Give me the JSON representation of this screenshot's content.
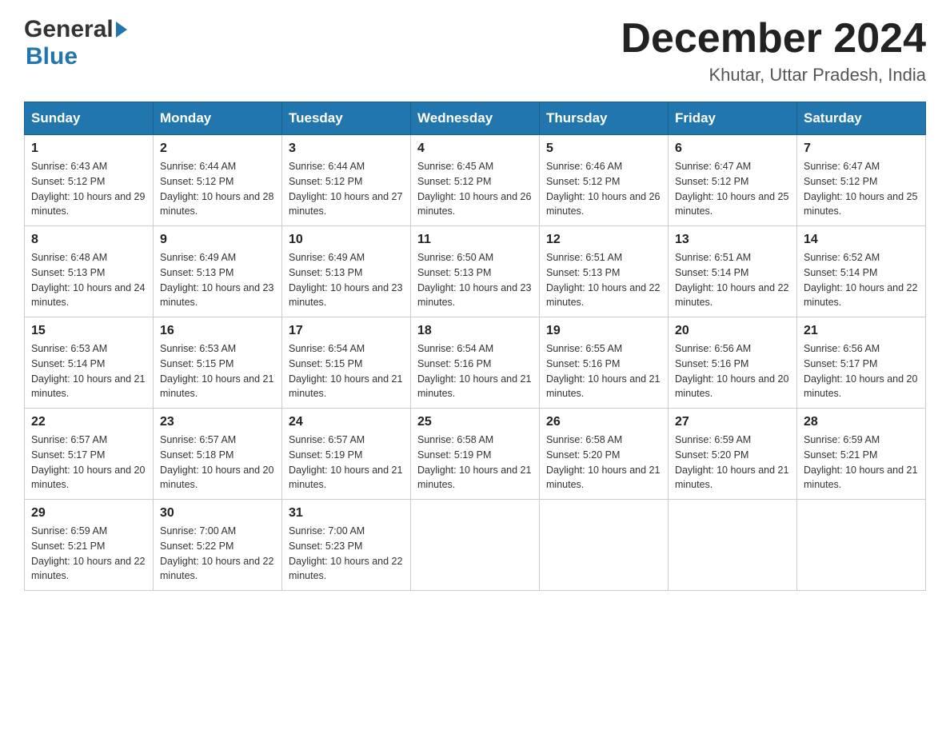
{
  "header": {
    "logo_general": "General",
    "logo_blue": "Blue",
    "month_title": "December 2024",
    "location": "Khutar, Uttar Pradesh, India"
  },
  "days_of_week": [
    "Sunday",
    "Monday",
    "Tuesday",
    "Wednesday",
    "Thursday",
    "Friday",
    "Saturday"
  ],
  "weeks": [
    [
      {
        "day": "1",
        "sunrise": "Sunrise: 6:43 AM",
        "sunset": "Sunset: 5:12 PM",
        "daylight": "Daylight: 10 hours and 29 minutes."
      },
      {
        "day": "2",
        "sunrise": "Sunrise: 6:44 AM",
        "sunset": "Sunset: 5:12 PM",
        "daylight": "Daylight: 10 hours and 28 minutes."
      },
      {
        "day": "3",
        "sunrise": "Sunrise: 6:44 AM",
        "sunset": "Sunset: 5:12 PM",
        "daylight": "Daylight: 10 hours and 27 minutes."
      },
      {
        "day": "4",
        "sunrise": "Sunrise: 6:45 AM",
        "sunset": "Sunset: 5:12 PM",
        "daylight": "Daylight: 10 hours and 26 minutes."
      },
      {
        "day": "5",
        "sunrise": "Sunrise: 6:46 AM",
        "sunset": "Sunset: 5:12 PM",
        "daylight": "Daylight: 10 hours and 26 minutes."
      },
      {
        "day": "6",
        "sunrise": "Sunrise: 6:47 AM",
        "sunset": "Sunset: 5:12 PM",
        "daylight": "Daylight: 10 hours and 25 minutes."
      },
      {
        "day": "7",
        "sunrise": "Sunrise: 6:47 AM",
        "sunset": "Sunset: 5:12 PM",
        "daylight": "Daylight: 10 hours and 25 minutes."
      }
    ],
    [
      {
        "day": "8",
        "sunrise": "Sunrise: 6:48 AM",
        "sunset": "Sunset: 5:13 PM",
        "daylight": "Daylight: 10 hours and 24 minutes."
      },
      {
        "day": "9",
        "sunrise": "Sunrise: 6:49 AM",
        "sunset": "Sunset: 5:13 PM",
        "daylight": "Daylight: 10 hours and 23 minutes."
      },
      {
        "day": "10",
        "sunrise": "Sunrise: 6:49 AM",
        "sunset": "Sunset: 5:13 PM",
        "daylight": "Daylight: 10 hours and 23 minutes."
      },
      {
        "day": "11",
        "sunrise": "Sunrise: 6:50 AM",
        "sunset": "Sunset: 5:13 PM",
        "daylight": "Daylight: 10 hours and 23 minutes."
      },
      {
        "day": "12",
        "sunrise": "Sunrise: 6:51 AM",
        "sunset": "Sunset: 5:13 PM",
        "daylight": "Daylight: 10 hours and 22 minutes."
      },
      {
        "day": "13",
        "sunrise": "Sunrise: 6:51 AM",
        "sunset": "Sunset: 5:14 PM",
        "daylight": "Daylight: 10 hours and 22 minutes."
      },
      {
        "day": "14",
        "sunrise": "Sunrise: 6:52 AM",
        "sunset": "Sunset: 5:14 PM",
        "daylight": "Daylight: 10 hours and 22 minutes."
      }
    ],
    [
      {
        "day": "15",
        "sunrise": "Sunrise: 6:53 AM",
        "sunset": "Sunset: 5:14 PM",
        "daylight": "Daylight: 10 hours and 21 minutes."
      },
      {
        "day": "16",
        "sunrise": "Sunrise: 6:53 AM",
        "sunset": "Sunset: 5:15 PM",
        "daylight": "Daylight: 10 hours and 21 minutes."
      },
      {
        "day": "17",
        "sunrise": "Sunrise: 6:54 AM",
        "sunset": "Sunset: 5:15 PM",
        "daylight": "Daylight: 10 hours and 21 minutes."
      },
      {
        "day": "18",
        "sunrise": "Sunrise: 6:54 AM",
        "sunset": "Sunset: 5:16 PM",
        "daylight": "Daylight: 10 hours and 21 minutes."
      },
      {
        "day": "19",
        "sunrise": "Sunrise: 6:55 AM",
        "sunset": "Sunset: 5:16 PM",
        "daylight": "Daylight: 10 hours and 21 minutes."
      },
      {
        "day": "20",
        "sunrise": "Sunrise: 6:56 AM",
        "sunset": "Sunset: 5:16 PM",
        "daylight": "Daylight: 10 hours and 20 minutes."
      },
      {
        "day": "21",
        "sunrise": "Sunrise: 6:56 AM",
        "sunset": "Sunset: 5:17 PM",
        "daylight": "Daylight: 10 hours and 20 minutes."
      }
    ],
    [
      {
        "day": "22",
        "sunrise": "Sunrise: 6:57 AM",
        "sunset": "Sunset: 5:17 PM",
        "daylight": "Daylight: 10 hours and 20 minutes."
      },
      {
        "day": "23",
        "sunrise": "Sunrise: 6:57 AM",
        "sunset": "Sunset: 5:18 PM",
        "daylight": "Daylight: 10 hours and 20 minutes."
      },
      {
        "day": "24",
        "sunrise": "Sunrise: 6:57 AM",
        "sunset": "Sunset: 5:19 PM",
        "daylight": "Daylight: 10 hours and 21 minutes."
      },
      {
        "day": "25",
        "sunrise": "Sunrise: 6:58 AM",
        "sunset": "Sunset: 5:19 PM",
        "daylight": "Daylight: 10 hours and 21 minutes."
      },
      {
        "day": "26",
        "sunrise": "Sunrise: 6:58 AM",
        "sunset": "Sunset: 5:20 PM",
        "daylight": "Daylight: 10 hours and 21 minutes."
      },
      {
        "day": "27",
        "sunrise": "Sunrise: 6:59 AM",
        "sunset": "Sunset: 5:20 PM",
        "daylight": "Daylight: 10 hours and 21 minutes."
      },
      {
        "day": "28",
        "sunrise": "Sunrise: 6:59 AM",
        "sunset": "Sunset: 5:21 PM",
        "daylight": "Daylight: 10 hours and 21 minutes."
      }
    ],
    [
      {
        "day": "29",
        "sunrise": "Sunrise: 6:59 AM",
        "sunset": "Sunset: 5:21 PM",
        "daylight": "Daylight: 10 hours and 22 minutes."
      },
      {
        "day": "30",
        "sunrise": "Sunrise: 7:00 AM",
        "sunset": "Sunset: 5:22 PM",
        "daylight": "Daylight: 10 hours and 22 minutes."
      },
      {
        "day": "31",
        "sunrise": "Sunrise: 7:00 AM",
        "sunset": "Sunset: 5:23 PM",
        "daylight": "Daylight: 10 hours and 22 minutes."
      },
      null,
      null,
      null,
      null
    ]
  ]
}
